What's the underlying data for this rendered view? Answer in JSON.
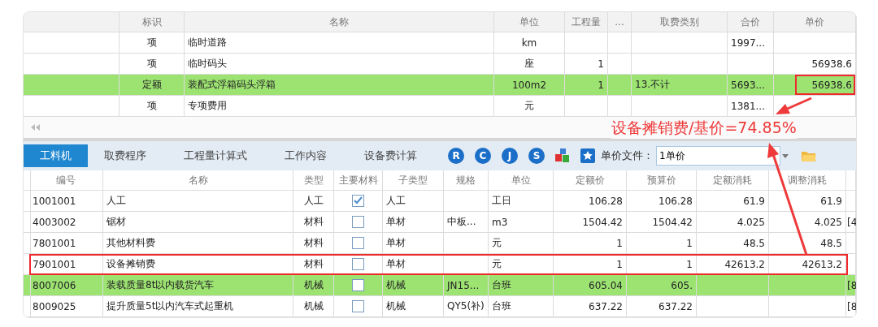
{
  "upper_table": {
    "columns": [
      "标识",
      "名称",
      "单位",
      "工程量",
      "...",
      "取费类别",
      "合价",
      "单价"
    ],
    "rows": [
      {
        "mark": "项",
        "name": "临时道路",
        "unit": "km",
        "total": "1997...",
        "selected": false,
        "price_highlighted": false
      },
      {
        "mark": "项",
        "name": "临时码头",
        "unit": "座",
        "quantity": "1",
        "unit_price": "56938.6",
        "selected": false,
        "price_highlighted": false
      },
      {
        "mark": "定额",
        "name": "装配式浮箱码头浮箱",
        "unit": "100m2",
        "quantity": "1",
        "fee_category": "13.不计",
        "total": "5693...",
        "unit_price": "56938.6",
        "selected": true,
        "price_highlighted": true
      },
      {
        "mark": "项",
        "name": "专项费用",
        "unit": "元",
        "total": "1381...",
        "selected": false,
        "price_highlighted": false
      }
    ]
  },
  "tabs": [
    {
      "label": "工料机",
      "selected": true
    },
    {
      "label": "取费程序",
      "selected": false
    },
    {
      "label": "工程量计算式",
      "selected": false
    },
    {
      "label": "工作内容",
      "selected": false
    },
    {
      "label": "设备费计算",
      "selected": false
    }
  ],
  "toolbar": {
    "buttons": [
      {
        "kind": "letter",
        "label": "R"
      },
      {
        "kind": "letter",
        "label": "C"
      },
      {
        "kind": "letter",
        "label": "J"
      },
      {
        "kind": "letter",
        "label": "S"
      },
      {
        "kind": "stack"
      },
      {
        "kind": "star"
      }
    ],
    "price_file_label": "单价文件：",
    "price_file_value": "1单价"
  },
  "lower_table": {
    "columns": [
      "编号",
      "名称",
      "类型",
      "主要材料",
      "子类型",
      "规格",
      "单位",
      "定额价",
      "预算价",
      "定额消耗",
      "调整消耗"
    ],
    "rows": [
      {
        "code": "1001001",
        "name": "人工",
        "type": "人工",
        "main_material": true,
        "subtype": "人工",
        "unit": "工日",
        "quota_price": "106.28",
        "budget_price": "106.28",
        "quota_use": "61.9",
        "adjusted_use": "61.9",
        "selected": false,
        "highlighted": false
      },
      {
        "code": "4003002",
        "name": "锯材",
        "type": "材料",
        "main_material": false,
        "subtype": "单材",
        "spec": "中板...",
        "unit": "m3",
        "quota_price": "1504.42",
        "budget_price": "1504.42",
        "quota_use": "4.025",
        "adjusted_use": "4.025",
        "column_13": "[4",
        "selected": false,
        "highlighted": false
      },
      {
        "code": "7801001",
        "name": "其他材料费",
        "type": "材料",
        "main_material": false,
        "subtype": "单材",
        "unit": "元",
        "quota_price": "1",
        "budget_price": "1",
        "quota_use": "48.5",
        "adjusted_use": "48.5",
        "selected": false,
        "highlighted": false
      },
      {
        "code": "7901001",
        "name": "设备摊销费",
        "type": "材料",
        "main_material": false,
        "subtype": "单材",
        "unit": "元",
        "quota_price": "1",
        "budget_price": "1",
        "quota_use": "42613.2",
        "adjusted_use": "42613.2",
        "selected": false,
        "highlighted": true
      },
      {
        "code": "8007006",
        "name": "装载质量8t以内载货汽车",
        "type": "机械",
        "main_material": false,
        "subtype": "机械",
        "spec": "JN15...",
        "unit": "台班",
        "quota_price": "605.04",
        "budget_price": "605.",
        "column_13": "[8",
        "selected": true,
        "highlighted": false
      },
      {
        "code": "8009025",
        "name": "提升质量5t以内汽车式起重机",
        "type": "机械",
        "main_material": false,
        "subtype": "机械",
        "spec": "QY5(补)",
        "unit": "台班",
        "quota_price": "637.22",
        "budget_price": "637.22",
        "column_13": "[8",
        "selected": false,
        "highlighted": false
      }
    ]
  },
  "annotation": {
    "text": "设备摊销费/基价=74.85%"
  }
}
